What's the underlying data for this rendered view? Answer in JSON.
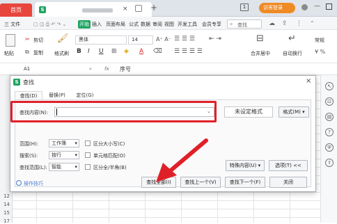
{
  "tabs": {
    "home": "首页",
    "file_icon": "S",
    "new_tab": "+"
  },
  "window": {
    "badge": "1",
    "login": "访客登录"
  },
  "menu": {
    "file": "三 文件",
    "items": [
      "开始",
      "插入",
      "页面布局",
      "公式",
      "数据",
      "审阅",
      "视图",
      "开发工具",
      "会员专享"
    ],
    "search_placeholder": "查找"
  },
  "ribbon": {
    "cut": "剪切",
    "copy": "复制",
    "format_painter": "格式刷",
    "paste": "粘贴",
    "font": "黑体",
    "size": "14",
    "bold": "B",
    "italic": "I",
    "underline": "U",
    "font_color": "A",
    "merge": "合并居中",
    "wrap": "自动换行",
    "number": "常规"
  },
  "formula": {
    "cell": "A1",
    "fx": "fx",
    "value": "序号"
  },
  "rows": [
    "1",
    "2",
    "3",
    "4",
    "5",
    "6",
    "7",
    "8",
    "9",
    "10",
    "11",
    "12",
    "13",
    "14",
    "15",
    "16",
    "17"
  ],
  "dialog": {
    "title": "查找",
    "tabs": [
      "查找(D)",
      "替换(P)",
      "定位(G)"
    ],
    "find_label": "查找内容(N):",
    "find_value": "",
    "format_status": "未设定格式",
    "format_button": "格式(M)",
    "scope_label": "范围(H):",
    "scope_value": "工作簿",
    "search_label": "搜索(S):",
    "search_value": "按行",
    "lookin_label": "查找范围(L):",
    "lookin_value": "智能",
    "case": "区分大小写(C)",
    "whole": "单元格匹配(O)",
    "width": "区分全/半角(B)",
    "special": "特殊内容(U)",
    "options": "选项(T) <<",
    "tips": "操作技巧",
    "find_all": "查找全部(I)",
    "find_prev": "查找上一个(V)",
    "find_next": "查找下一个(F)",
    "close": "关闭"
  },
  "colors": {
    "accent_green": "#1ea462",
    "home_red": "#e8453c",
    "highlight_red": "#e02028",
    "login_orange": "#f08a24"
  }
}
